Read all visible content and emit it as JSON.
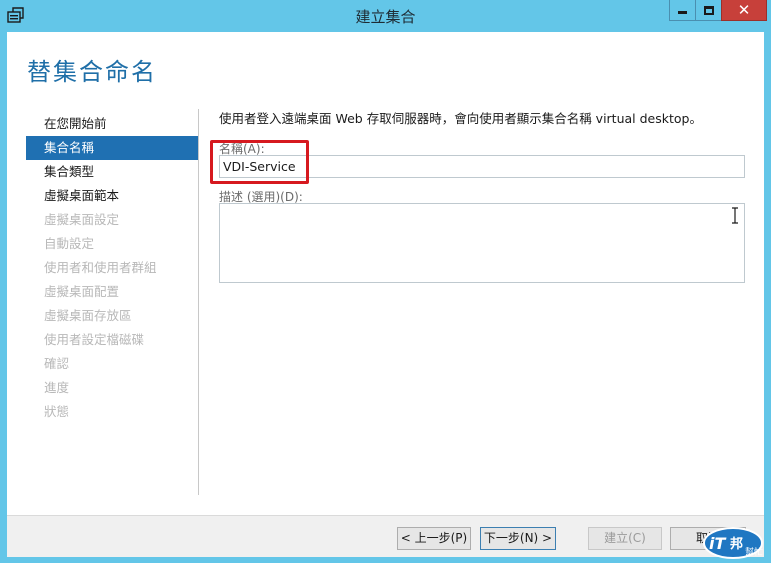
{
  "window": {
    "title": "建立集合",
    "close_glyph": "✕",
    "icons": {
      "app": "server-manager-icon",
      "minimize": "minimize-icon",
      "maximize": "maximize-icon",
      "close": "close-icon"
    }
  },
  "page": {
    "title": "替集合命名"
  },
  "nav": {
    "items": [
      {
        "label": "在您開始前",
        "state": "normal"
      },
      {
        "label": "集合名稱",
        "state": "selected"
      },
      {
        "label": "集合類型",
        "state": "normal"
      },
      {
        "label": "虛擬桌面範本",
        "state": "normal"
      },
      {
        "label": "虛擬桌面設定",
        "state": "disabled"
      },
      {
        "label": "自動設定",
        "state": "disabled"
      },
      {
        "label": "使用者和使用者群組",
        "state": "disabled"
      },
      {
        "label": "虛擬桌面配置",
        "state": "disabled"
      },
      {
        "label": "虛擬桌面存放區",
        "state": "disabled"
      },
      {
        "label": "使用者設定檔磁碟",
        "state": "disabled"
      },
      {
        "label": "確認",
        "state": "disabled"
      },
      {
        "label": "進度",
        "state": "disabled"
      },
      {
        "label": "狀態",
        "state": "disabled"
      }
    ]
  },
  "form": {
    "intro": "使用者登入遠端桌面 Web 存取伺服器時，會向使用者顯示集合名稱 virtual desktop。",
    "name_label": "名稱(A):",
    "name_value": "VDI-Service",
    "description_label": "描述 (選用)(D):",
    "description_value": ""
  },
  "footer": {
    "prev_label": "< 上一步(P)",
    "next_label": "下一步(N) >",
    "create_label": "建立(C)",
    "cancel_label": "取消"
  },
  "watermark": {
    "badge": "iT",
    "brand": "邦",
    "sub": "幫忙"
  },
  "colors": {
    "titlebar": "#63c6e8",
    "accent": "#1f70b2",
    "title_text": "#1f6fa8",
    "highlight": "#d6191f",
    "close_button": "#c7403a"
  }
}
